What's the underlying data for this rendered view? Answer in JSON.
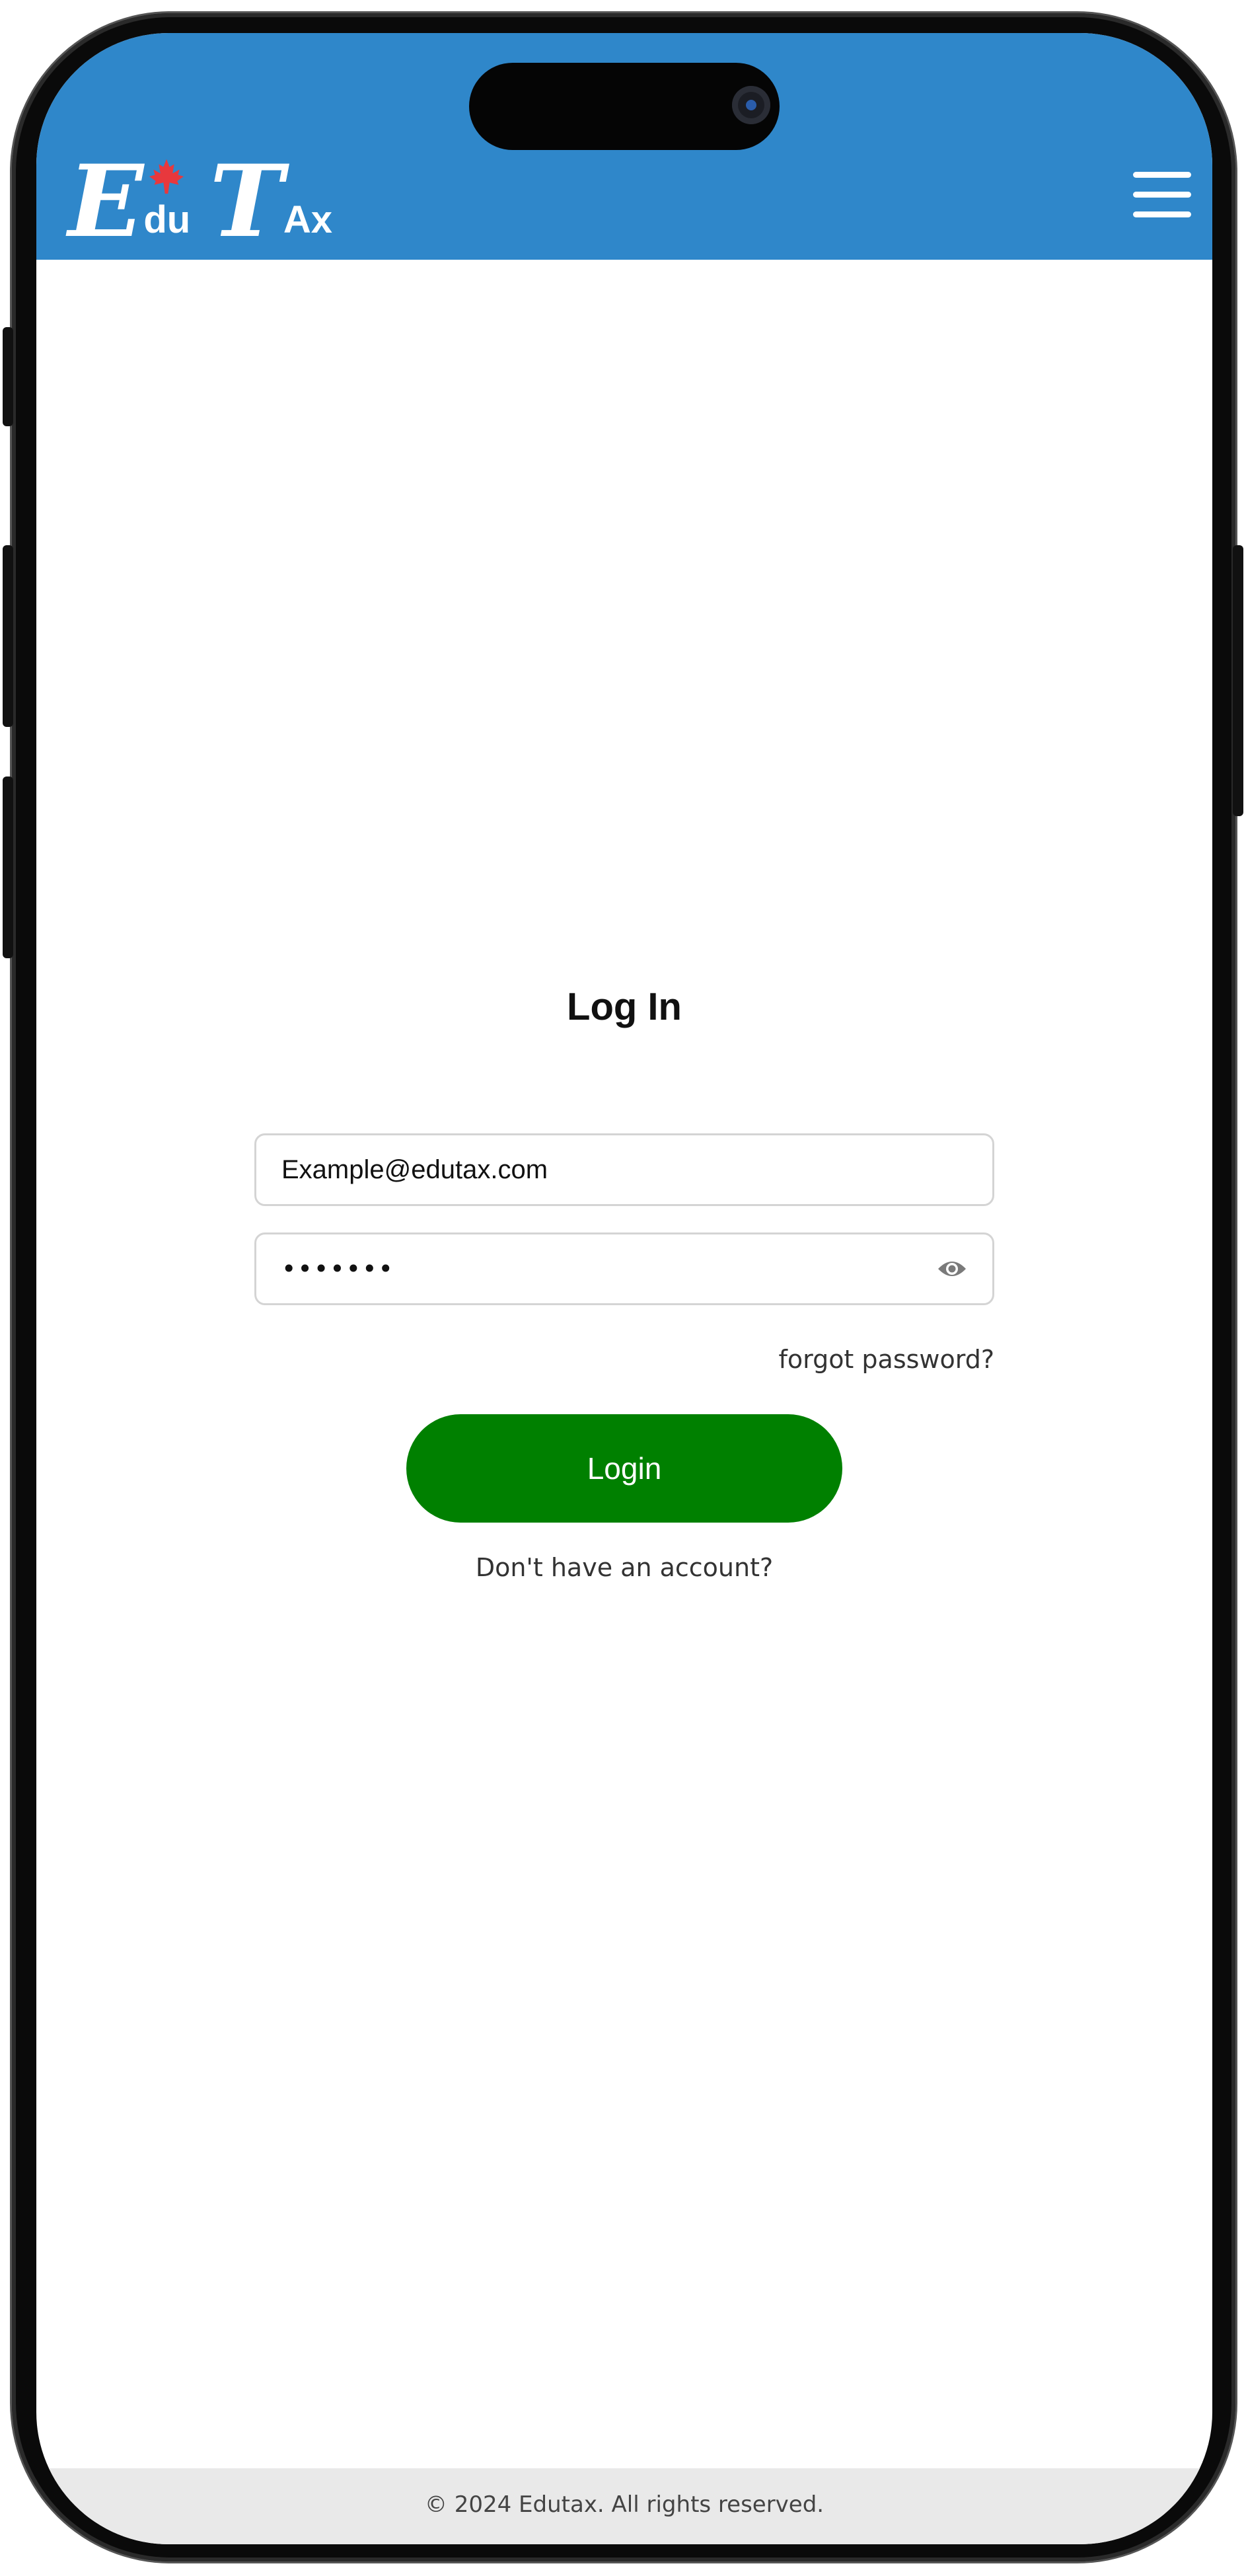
{
  "header": {
    "logo": {
      "letter_e": "E",
      "text_du": "du",
      "letter_t": "T",
      "text_ax": "Ax",
      "brand_color": "#2f87ca",
      "maple_leaf_color": "#e8383d"
    },
    "menu_icon": "hamburger-icon"
  },
  "main": {
    "title": "Log In",
    "email": {
      "value": "Example@edutax.com"
    },
    "password": {
      "masked_value": "•••••••",
      "toggle_icon": "eye-icon"
    },
    "forgot_password": "forgot password?",
    "login_button": "Login",
    "login_button_color": "#008000",
    "signup_link": "Don't have an account?"
  },
  "footer": {
    "copyright": "© 2024 Edutax. All rights reserved."
  }
}
